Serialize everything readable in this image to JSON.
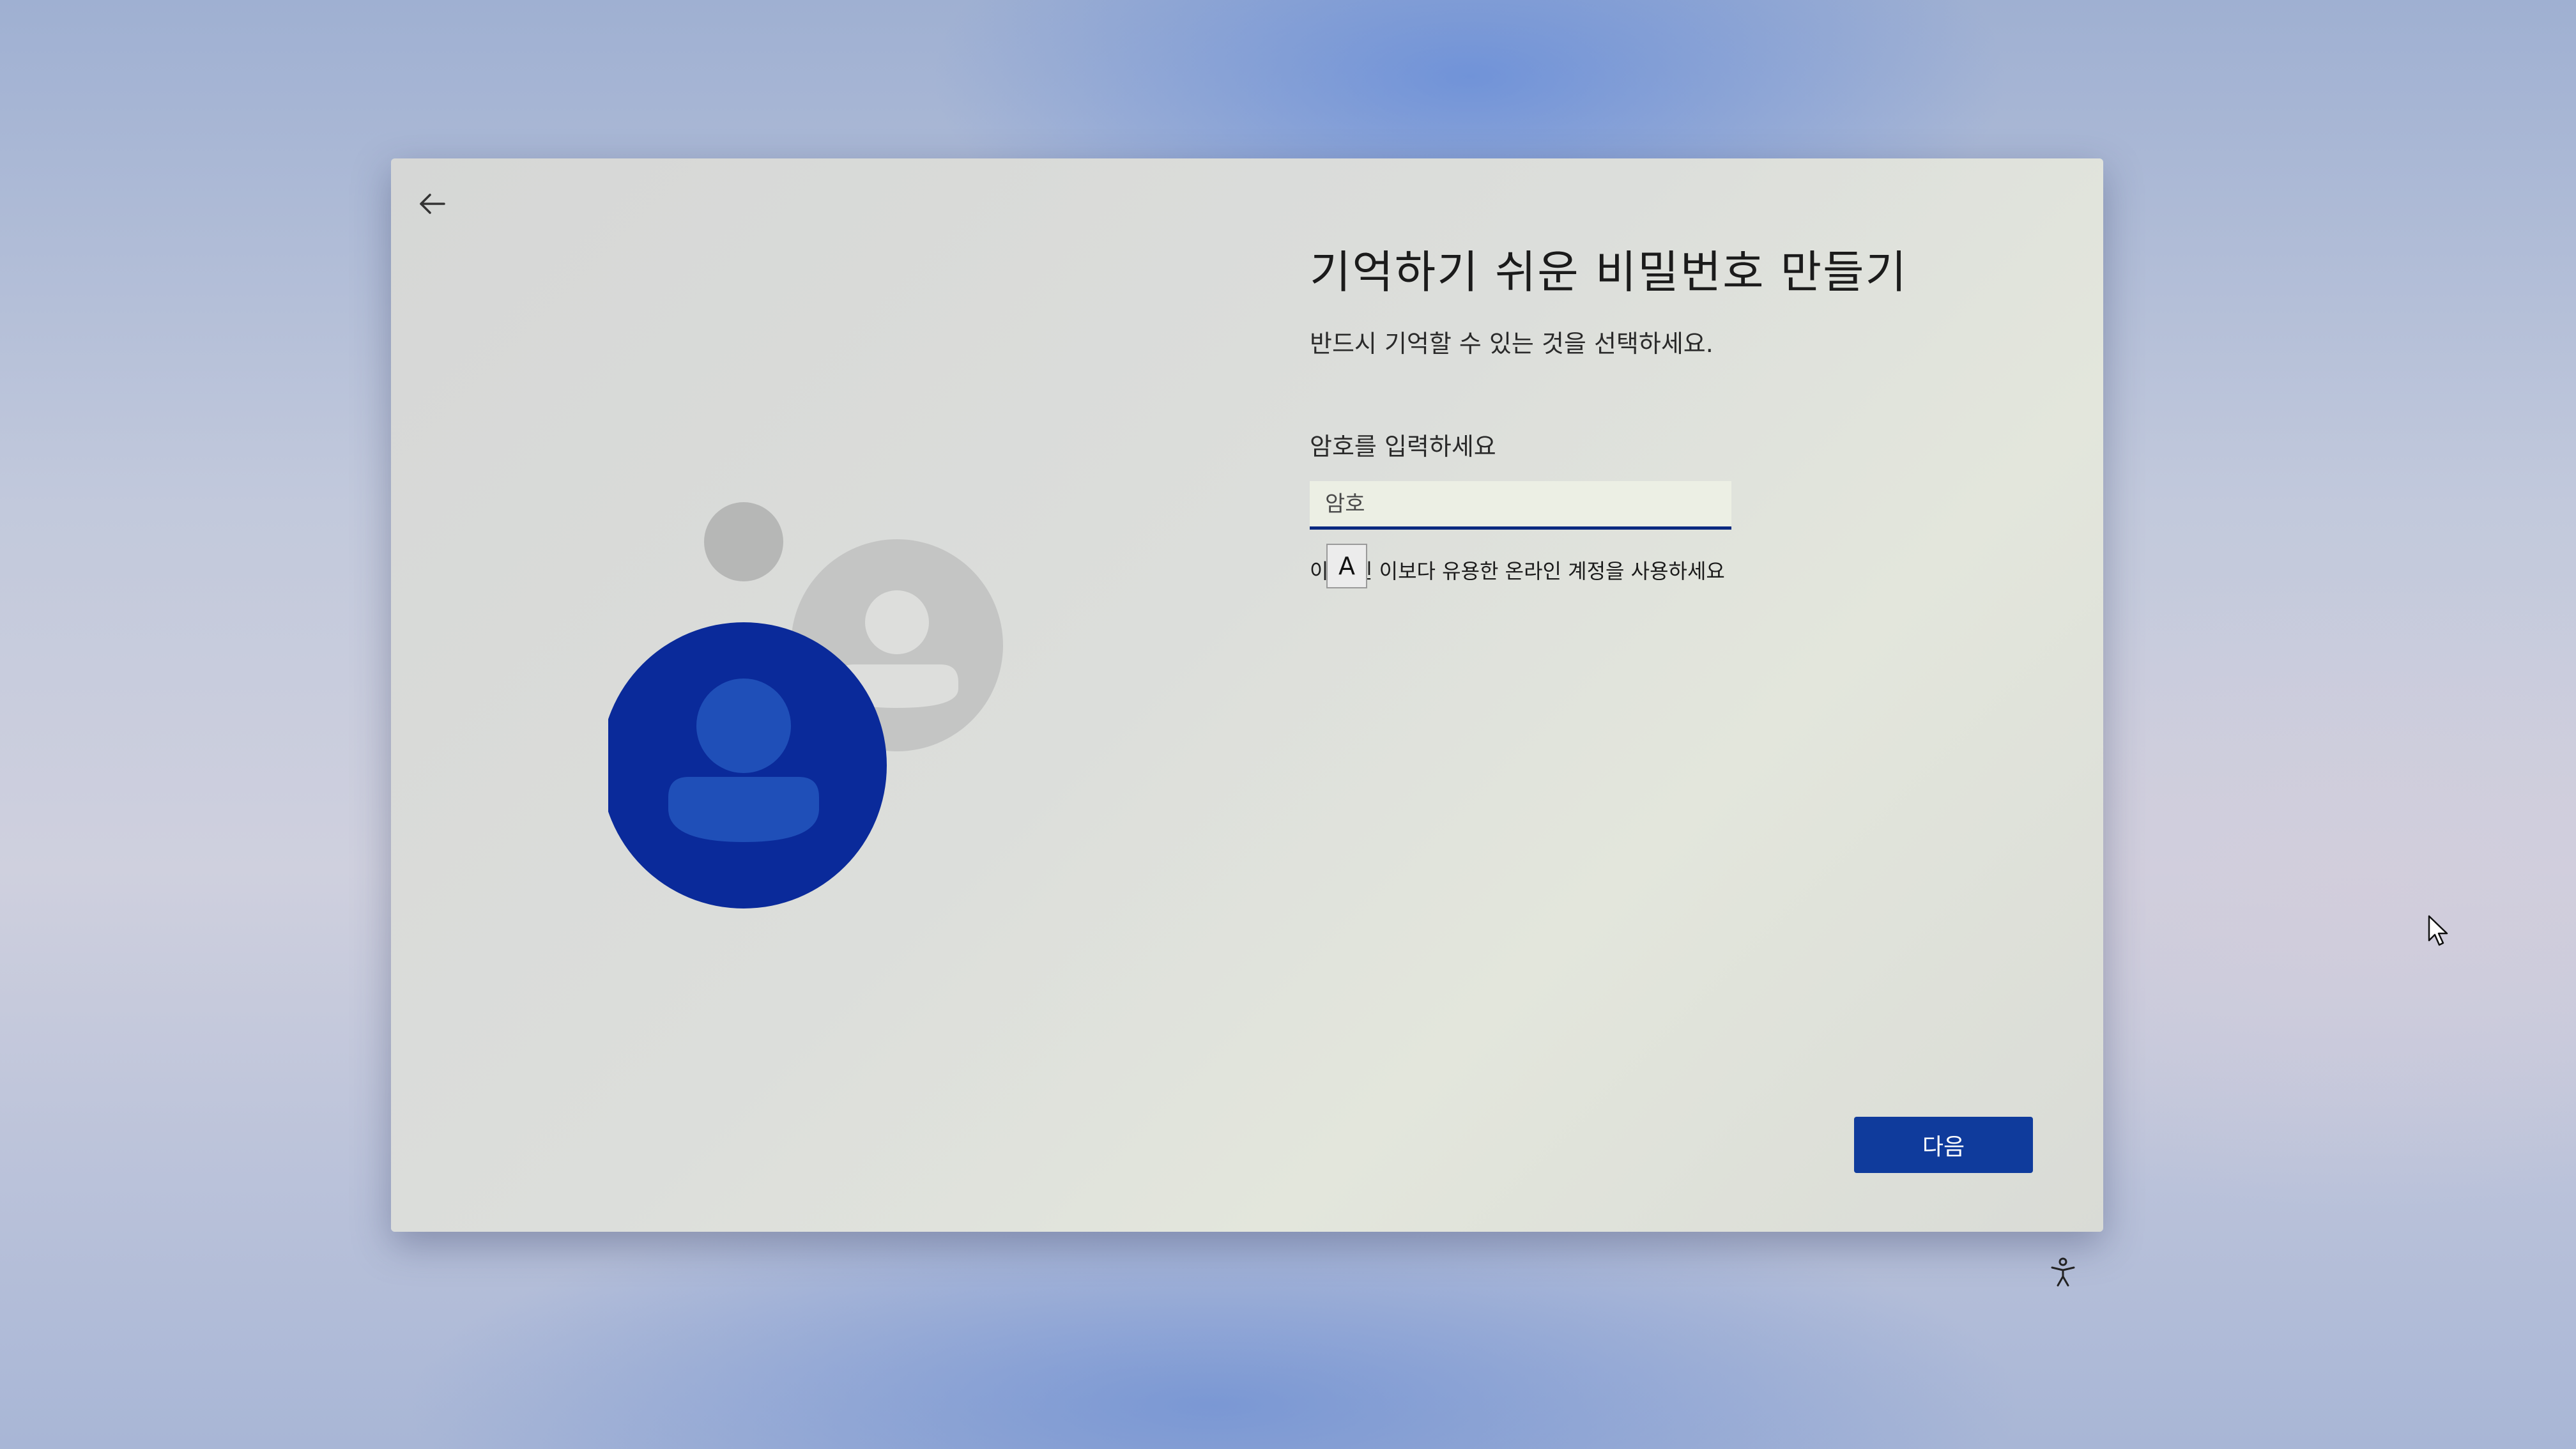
{
  "page": {
    "title": "기억하기 쉬운 비밀번호 만들기",
    "subtitle": "반드시 기억할 수 있는 것을 선택하세요."
  },
  "password": {
    "label": "암호를 입력하세요",
    "placeholder": "암호",
    "value": ""
  },
  "ime": {
    "mode": "A"
  },
  "links": {
    "online_account": "이 대신 이보다 유용한 온라인 계정을 사용하세요"
  },
  "buttons": {
    "next": "다음"
  },
  "icons": {
    "back": "back-arrow-icon",
    "accessibility": "accessibility-icon",
    "cursor": "mouse-pointer-icon"
  },
  "colors": {
    "accent": "#0f3b9c",
    "user_avatar": "#0a2a9a",
    "secondary_avatar": "#b9bab9"
  }
}
